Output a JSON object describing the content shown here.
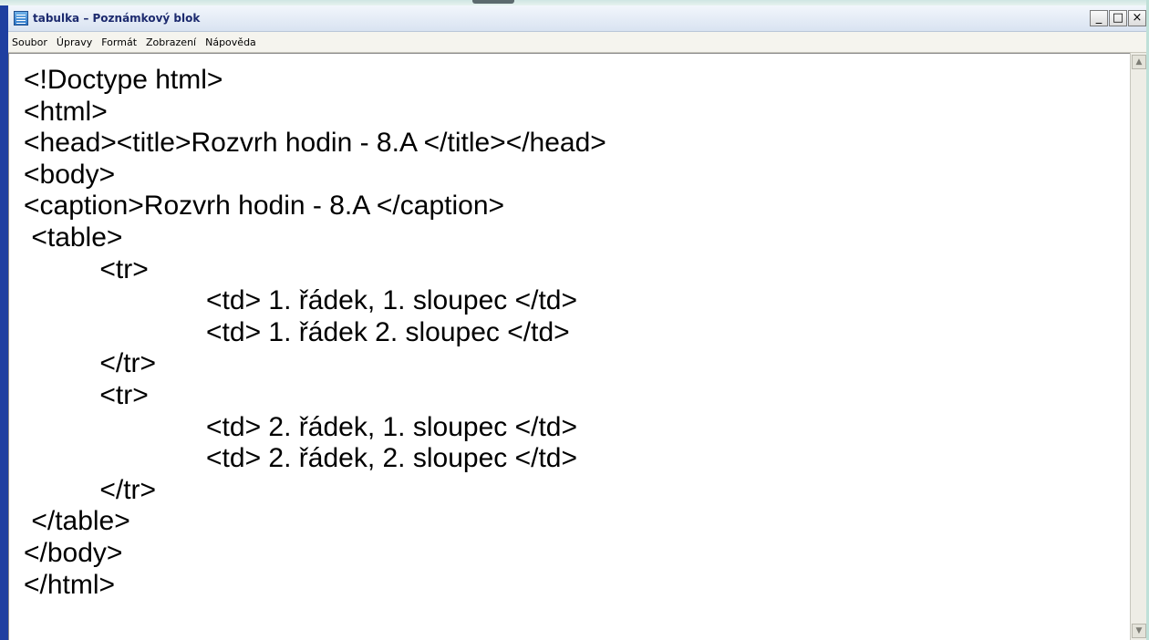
{
  "window": {
    "title": "tabulka – Poznámkový blok",
    "controls": {
      "minimize": "_",
      "maximize": "□",
      "close": "×"
    }
  },
  "menu": [
    "Soubor",
    "Úpravy",
    "Formát",
    "Zobrazení",
    "Nápověda"
  ],
  "editor": {
    "lines": [
      "<!Doctype html>",
      "<html>",
      "<head><title>Rozvrh hodin - 8.A </title></head>",
      "<body>",
      "<caption>Rozvrh hodin - 8.A </caption>",
      " <table>",
      "          <tr>",
      "                        <td> 1. řádek, 1. sloupec </td>",
      "                        <td> 1. řádek 2. sloupec </td>",
      "          </tr>",
      "          <tr>",
      "                        <td> 2. řádek, 1. sloupec </td>",
      "                        <td> 2. řádek, 2. sloupec </td>",
      "          </tr>",
      " </table>",
      "</body>",
      "</html>"
    ]
  },
  "scrollbar": {
    "up_icon": "arrow-up-icon",
    "down_icon": "arrow-down-icon"
  },
  "colors": {
    "window_border": "#1f3fa0",
    "title_text": "#1c2a6e",
    "menubar_bg": "#f5f4ee"
  }
}
